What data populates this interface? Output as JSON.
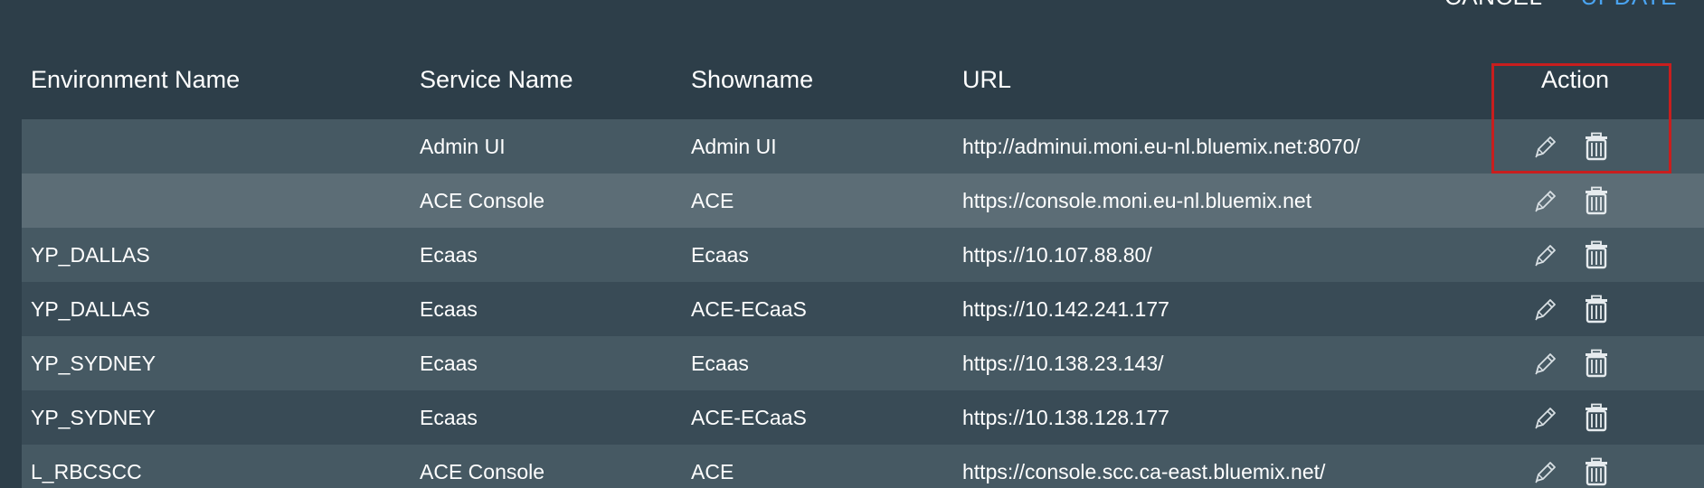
{
  "top_actions": {
    "cancel_label": "CANCEL",
    "update_label": "UPDATE",
    "update_color": "#4aa3f0"
  },
  "table": {
    "headers": {
      "environment_name": "Environment Name",
      "service_name": "Service Name",
      "showname": "Showname",
      "url": "URL",
      "action": "Action"
    },
    "rows": [
      {
        "environment_name": "",
        "service_name": "Admin UI",
        "showname": "Admin UI",
        "url": "http://adminui.moni.eu-nl.bluemix.net:8070/"
      },
      {
        "environment_name": "",
        "service_name": "ACE Console",
        "showname": "ACE",
        "url": "https://console.moni.eu-nl.bluemix.net"
      },
      {
        "environment_name": "YP_DALLAS",
        "service_name": "Ecaas",
        "showname": "Ecaas",
        "url": "https://10.107.88.80/"
      },
      {
        "environment_name": "YP_DALLAS",
        "service_name": "Ecaas",
        "showname": "ACE-ECaaS",
        "url": "https://10.142.241.177"
      },
      {
        "environment_name": "YP_SYDNEY",
        "service_name": "Ecaas",
        "showname": "Ecaas",
        "url": "https://10.138.23.143/"
      },
      {
        "environment_name": "YP_SYDNEY",
        "service_name": "Ecaas",
        "showname": "ACE-ECaaS",
        "url": "https://10.138.128.177"
      },
      {
        "environment_name": "L_RBCSCC",
        "service_name": "ACE Console",
        "showname": "ACE",
        "url": "https://console.scc.ca-east.bluemix.net/"
      }
    ],
    "row_actions": {
      "edit_icon": "pencil-icon",
      "delete_icon": "trash-icon"
    }
  },
  "colors": {
    "background": "#2d3e49",
    "row_odd": "#465963",
    "row_even": "#394b56",
    "row_highlight": "#5c6d76",
    "focus_box": "#c81e1e"
  }
}
